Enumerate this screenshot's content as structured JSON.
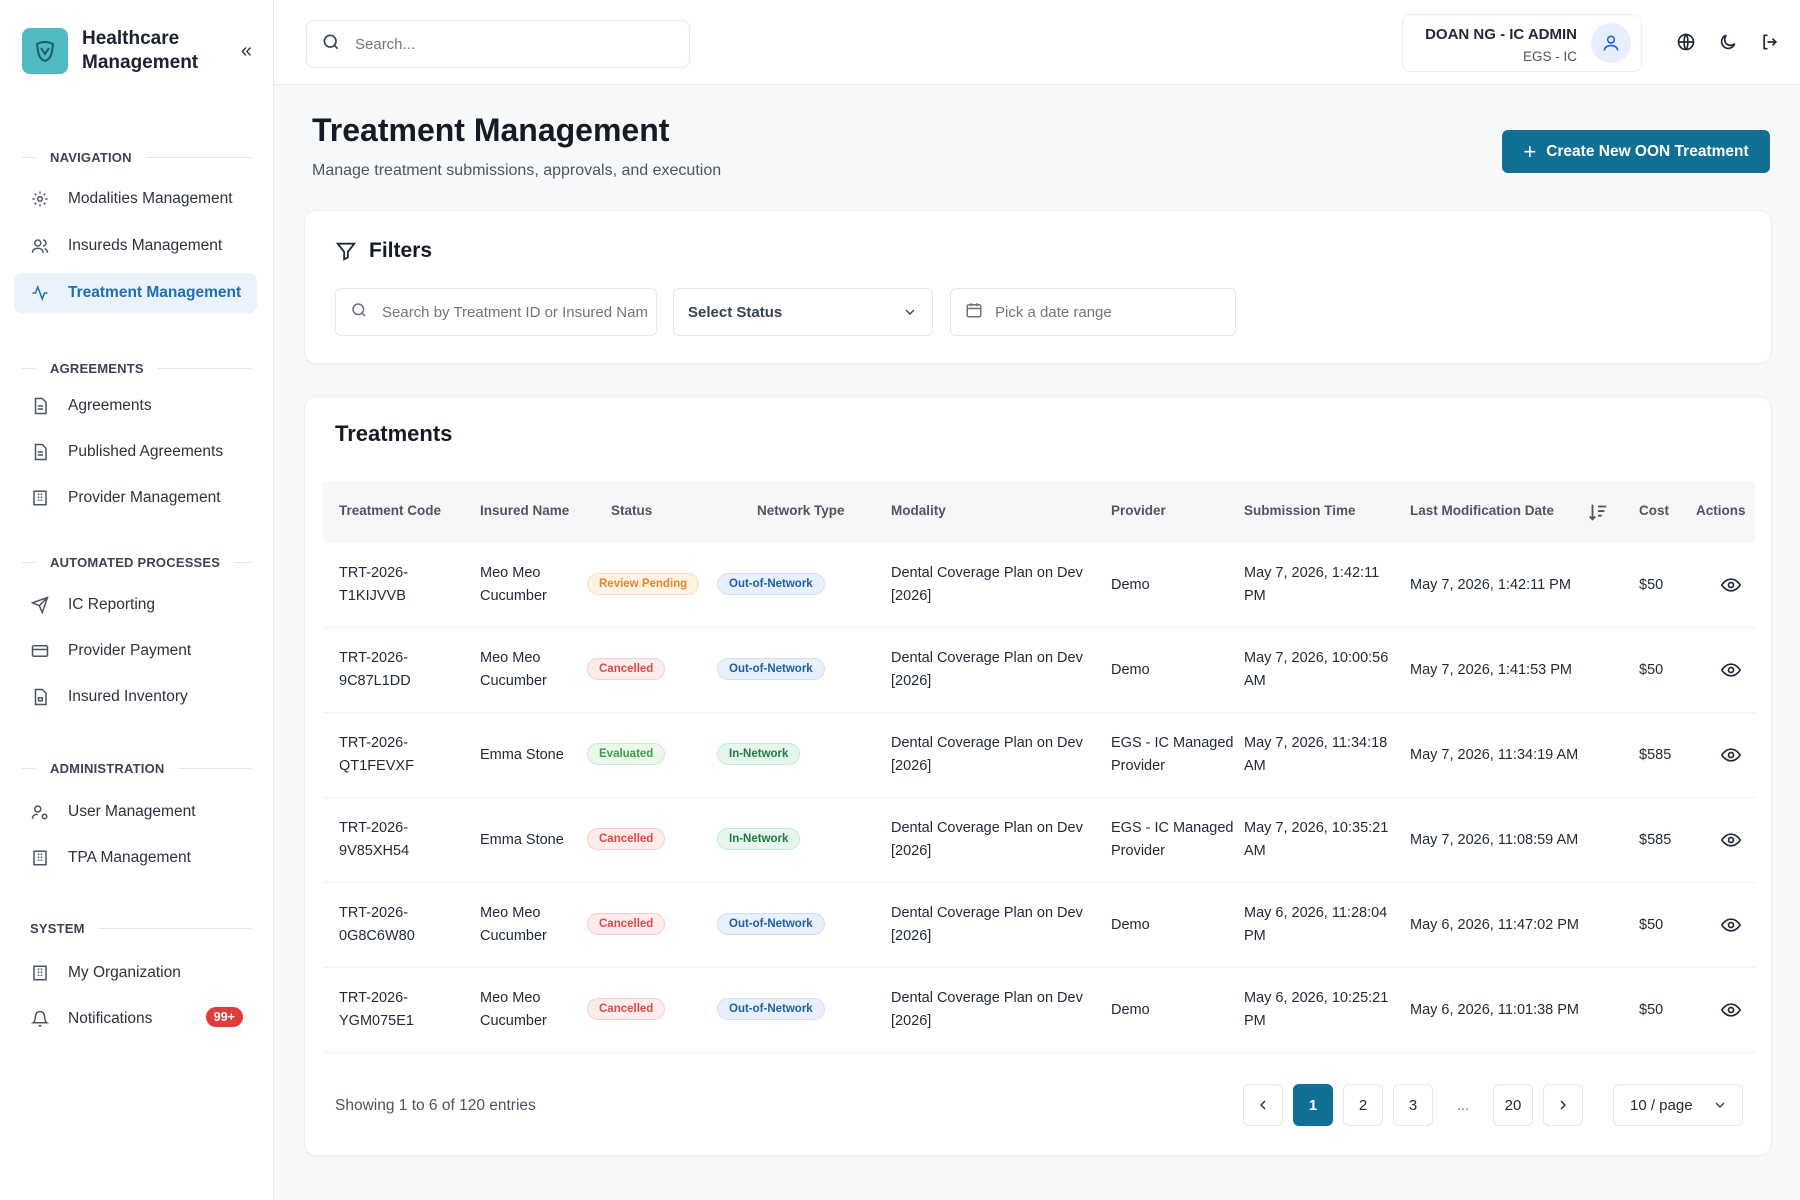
{
  "brand": {
    "name": "Healthcare Management"
  },
  "sidebar": {
    "sections": [
      {
        "title": "NAVIGATION"
      },
      {
        "title": "AGREEMENTS"
      },
      {
        "title": "AUTOMATED PROCESSES"
      },
      {
        "title": "ADMINISTRATION"
      },
      {
        "title": "SYSTEM"
      }
    ],
    "items": [
      {
        "label": "Modalities Management",
        "icon": "gear-icon"
      },
      {
        "label": "Insureds Management",
        "icon": "users-icon"
      },
      {
        "label": "Treatment Management",
        "icon": "activity-icon",
        "active": true
      },
      {
        "label": "Agreements",
        "icon": "document-icon"
      },
      {
        "label": "Published Agreements",
        "icon": "document-icon"
      },
      {
        "label": "Provider Management",
        "icon": "building-icon"
      },
      {
        "label": "IC Reporting",
        "icon": "send-icon"
      },
      {
        "label": "Provider Payment",
        "icon": "credit-card-icon"
      },
      {
        "label": "Insured Inventory",
        "icon": "file-lock-icon"
      },
      {
        "label": "User Management",
        "icon": "user-cog-icon"
      },
      {
        "label": "TPA Management",
        "icon": "building-icon"
      },
      {
        "label": "My Organization",
        "icon": "building-icon"
      },
      {
        "label": "Notifications",
        "icon": "bell-icon",
        "badge": "99+"
      }
    ]
  },
  "topbar": {
    "search_placeholder": "Search...",
    "user_name": "DOAN NG - IC ADMIN",
    "user_org": "EGS - IC"
  },
  "page": {
    "title": "Treatment Management",
    "subtitle": "Manage treatment submissions, approvals, and execution",
    "create_label": "Create New OON Treatment"
  },
  "filters": {
    "title": "Filters",
    "search_placeholder": "Search by Treatment ID or Insured Name",
    "status_label": "Select Status",
    "date_placeholder": "Pick a date range"
  },
  "table": {
    "title": "Treatments",
    "headers": [
      "Treatment Code",
      "Insured Name",
      "Status",
      "Network Type",
      "Modality",
      "Provider",
      "Submission Time",
      "Last Modification Date",
      "Cost",
      "Actions"
    ],
    "rows": [
      {
        "code": [
          "TRT-2026-",
          "T1KIJVVB"
        ],
        "name": [
          "Meo Meo",
          "Cucumber"
        ],
        "status": "Review Pending",
        "status_kind": "review",
        "network": "Out-of-Network",
        "network_kind": "out",
        "modality": [
          "Dental Coverage Plan on Dev",
          "[2026]"
        ],
        "provider": [
          "Demo"
        ],
        "submitted": [
          "May 7, 2026, 1:42:11",
          "PM"
        ],
        "modified": "May 7, 2026, 1:42:11 PM",
        "cost": "$50"
      },
      {
        "code": [
          "TRT-2026-",
          "9C87L1DD"
        ],
        "name": [
          "Meo Meo",
          "Cucumber"
        ],
        "status": "Cancelled",
        "status_kind": "cancel",
        "network": "Out-of-Network",
        "network_kind": "out",
        "modality": [
          "Dental Coverage Plan on Dev",
          "[2026]"
        ],
        "provider": [
          "Demo"
        ],
        "submitted": [
          "May 7, 2026, 10:00:56",
          "AM"
        ],
        "modified": "May 7, 2026, 1:41:53 PM",
        "cost": "$50"
      },
      {
        "code": [
          "TRT-2026-",
          "QT1FEVXF"
        ],
        "name": [
          "Emma Stone"
        ],
        "status": "Evaluated",
        "status_kind": "eval",
        "network": "In-Network",
        "network_kind": "in",
        "modality": [
          "Dental Coverage Plan on Dev",
          "[2026]"
        ],
        "provider": [
          "EGS - IC Managed",
          "Provider"
        ],
        "submitted": [
          "May 7, 2026, 11:34:18",
          "AM"
        ],
        "modified": "May 7, 2026, 11:34:19 AM",
        "cost": "$585"
      },
      {
        "code": [
          "TRT-2026-",
          "9V85XH54"
        ],
        "name": [
          "Emma Stone"
        ],
        "status": "Cancelled",
        "status_kind": "cancel",
        "network": "In-Network",
        "network_kind": "in",
        "modality": [
          "Dental Coverage Plan on Dev",
          "[2026]"
        ],
        "provider": [
          "EGS - IC Managed",
          "Provider"
        ],
        "submitted": [
          "May 7, 2026, 10:35:21",
          "AM"
        ],
        "modified": "May 7, 2026, 11:08:59 AM",
        "cost": "$585"
      },
      {
        "code": [
          "TRT-2026-",
          "0G8C6W80"
        ],
        "name": [
          "Meo Meo",
          "Cucumber"
        ],
        "status": "Cancelled",
        "status_kind": "cancel",
        "network": "Out-of-Network",
        "network_kind": "out",
        "modality": [
          "Dental Coverage Plan on Dev",
          "[2026]"
        ],
        "provider": [
          "Demo"
        ],
        "submitted": [
          "May 6, 2026, 11:28:04",
          "PM"
        ],
        "modified": "May 6, 2026, 11:47:02 PM",
        "cost": "$50"
      },
      {
        "code": [
          "TRT-2026-",
          "YGM075E1"
        ],
        "name": [
          "Meo Meo",
          "Cucumber"
        ],
        "status": "Cancelled",
        "status_kind": "cancel",
        "network": "Out-of-Network",
        "network_kind": "out",
        "modality": [
          "Dental Coverage Plan on Dev",
          "[2026]"
        ],
        "provider": [
          "Demo"
        ],
        "submitted": [
          "May 6, 2026, 10:25:21",
          "PM"
        ],
        "modified": "May 6, 2026, 11:01:38 PM",
        "cost": "$50"
      }
    ],
    "showing": "Showing 1 to 6 of 120 entries"
  },
  "pagination": {
    "pages": [
      "1",
      "2",
      "3",
      "...",
      "20"
    ],
    "current": "1",
    "page_size": "10 / page"
  },
  "colors": {
    "accent": "#0f6f94",
    "active_nav": "#1f6fb3",
    "brand_logo": "#4fb9c4",
    "badge": "#e23b3b"
  }
}
